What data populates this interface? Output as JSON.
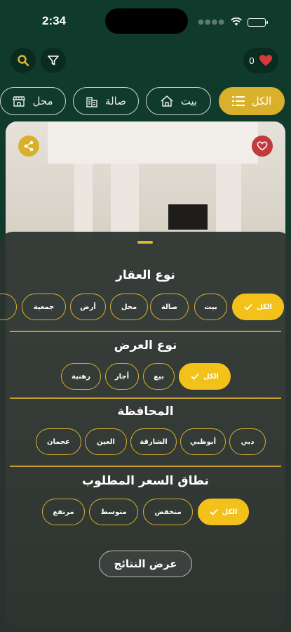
{
  "status": {
    "time": "2:34"
  },
  "header": {
    "favorites_count": "0"
  },
  "categories": [
    {
      "label": "الكل",
      "icon": "list-icon"
    },
    {
      "label": "بيت",
      "icon": "house-icon"
    },
    {
      "label": "صالة",
      "icon": "building-icon"
    },
    {
      "label": "محل",
      "icon": "shop-icon"
    }
  ],
  "filter": {
    "property_type": {
      "title": "نوع العقار",
      "options": [
        "الكل",
        "بيت",
        "صالة",
        "محل",
        "أرض",
        "جمعية"
      ]
    },
    "offer_type": {
      "title": "نوع العرض",
      "options": [
        "الكل",
        "بيع",
        "أجار",
        "رهنية"
      ]
    },
    "governorate": {
      "title": "المحافظة",
      "options": [
        "دبي",
        "أبوظبي",
        "الشارقة",
        "العين",
        "عجمان"
      ]
    },
    "price_range": {
      "title": "نطاق السعر المطلوب",
      "options": [
        "الكل",
        "منخفض",
        "متوسط",
        "مرتفع"
      ]
    },
    "results_button": "عرض النتائج"
  },
  "colors": {
    "accent": "#D9B02C",
    "background": "#0F3A2C",
    "favorite": "#C23B3B"
  }
}
